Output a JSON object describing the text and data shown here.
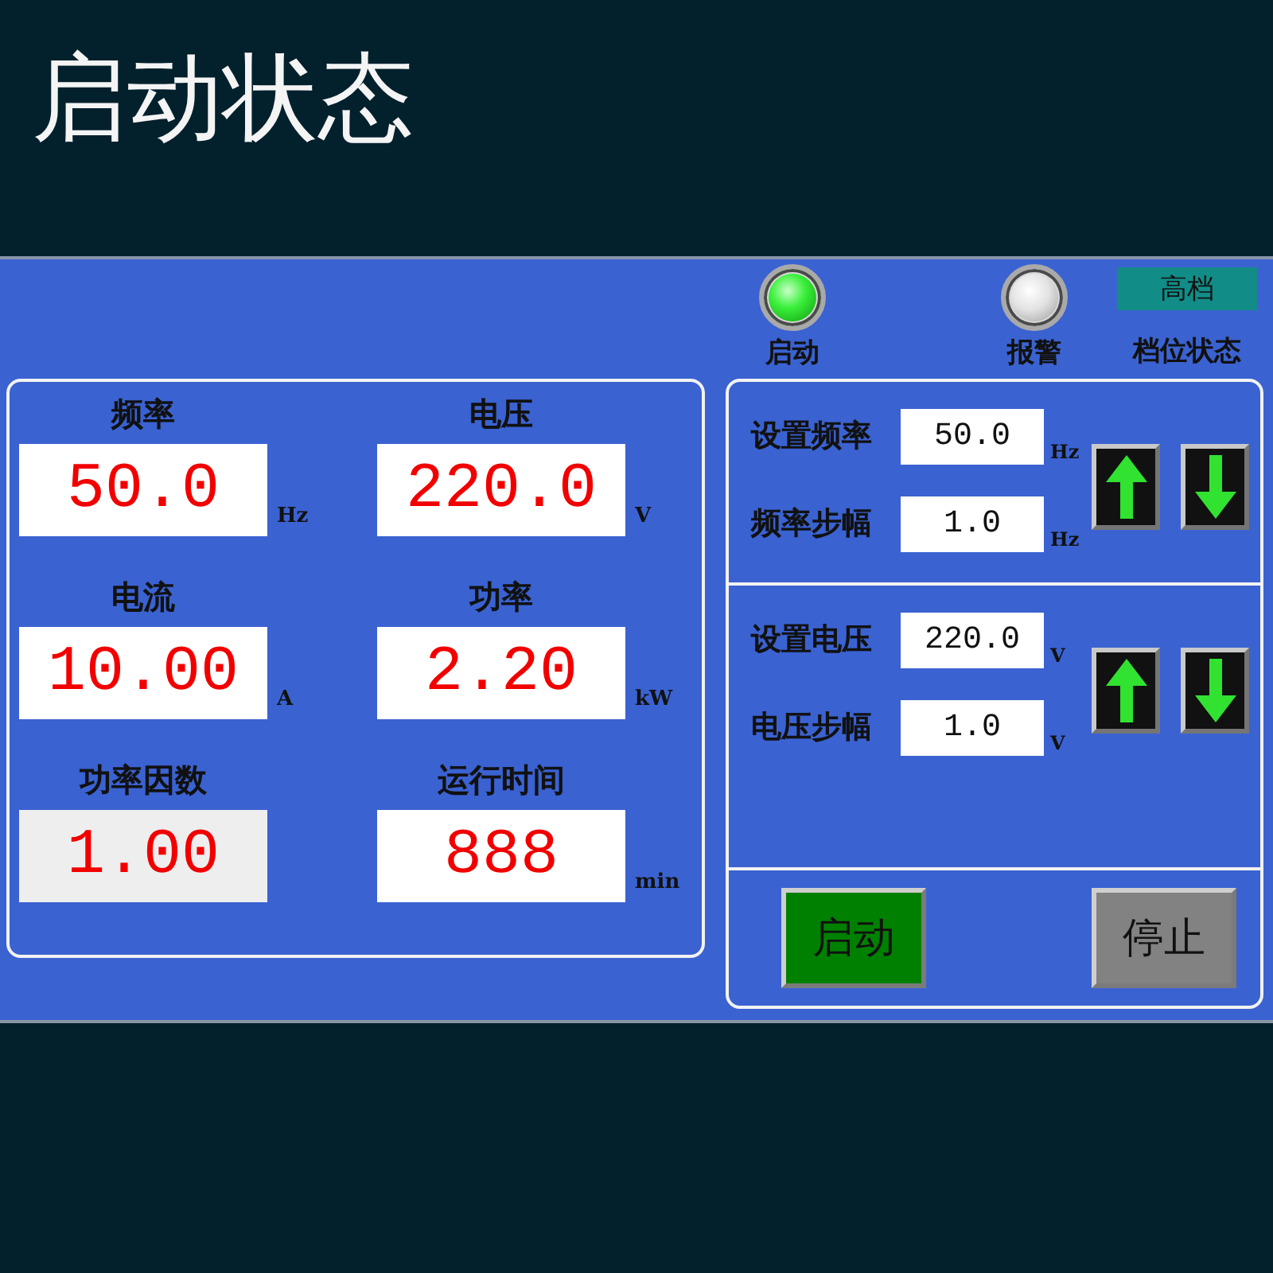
{
  "header": {
    "title": "启动状态"
  },
  "indicators": [
    {
      "kind": "lamp",
      "label": "启动",
      "on": true
    },
    {
      "kind": "lamp",
      "label": "报警",
      "on": false
    },
    {
      "kind": "badge",
      "value": "高档",
      "label": "档位状态"
    }
  ],
  "readings": [
    {
      "kind": "plain",
      "label": "频率",
      "value": "50.0",
      "unit": "Hz"
    },
    {
      "kind": "plain",
      "label": "电压",
      "value": "220.0",
      "unit": "V"
    },
    {
      "kind": "plain",
      "label": "电流",
      "value": "10.00",
      "unit": "A"
    },
    {
      "kind": "plain",
      "label": "功率",
      "value": "2.20",
      "unit": "kW"
    },
    {
      "kind": "shaded",
      "label": "功率因数",
      "value": "1.00"
    },
    {
      "kind": "plain",
      "label": "运行时间",
      "value": "888",
      "unit": "min"
    }
  ],
  "setpoint_groups": [
    {
      "fields": [
        {
          "label": "设置频率",
          "value": "50.0",
          "unit": "Hz"
        },
        {
          "label": "频率步幅",
          "value": "1.0",
          "unit": "Hz"
        }
      ]
    },
    {
      "fields": [
        {
          "label": "设置电压",
          "value": "220.0",
          "unit": "V"
        },
        {
          "label": "电压步幅",
          "value": "1.0",
          "unit": "V"
        }
      ]
    }
  ],
  "actions": [
    {
      "kind": "start",
      "label": "启动"
    },
    {
      "kind": "stop",
      "label": "停止"
    }
  ]
}
